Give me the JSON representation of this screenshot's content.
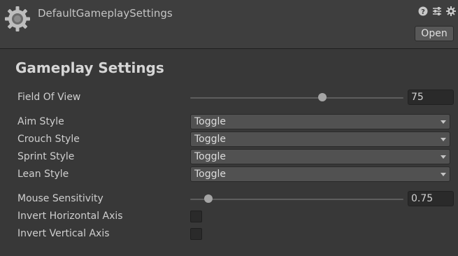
{
  "header": {
    "asset_name": "DefaultGameplaySettings",
    "open_label": "Open",
    "icons": [
      "gear-asset-icon",
      "help-icon",
      "preset-icon",
      "settings-gear-icon"
    ]
  },
  "section": {
    "title": "Gameplay Settings"
  },
  "fields": {
    "field_of_view": {
      "label": "Field Of View",
      "value": "75",
      "slider_fraction": 0.62
    },
    "aim_style": {
      "label": "Aim Style",
      "selected": "Toggle"
    },
    "crouch_style": {
      "label": "Crouch Style",
      "selected": "Toggle"
    },
    "sprint_style": {
      "label": "Sprint Style",
      "selected": "Toggle"
    },
    "lean_style": {
      "label": "Lean Style",
      "selected": "Toggle"
    },
    "mouse_sensitivity": {
      "label": "Mouse Sensitivity",
      "value": "0.75",
      "slider_fraction": 0.08
    },
    "invert_horizontal": {
      "label": "Invert Horizontal Axis",
      "checked": false
    },
    "invert_vertical": {
      "label": "Invert Vertical Axis",
      "checked": false
    }
  },
  "colors": {
    "background": "#383838",
    "header": "#3e3e3e",
    "text": "#d2d2d2"
  }
}
